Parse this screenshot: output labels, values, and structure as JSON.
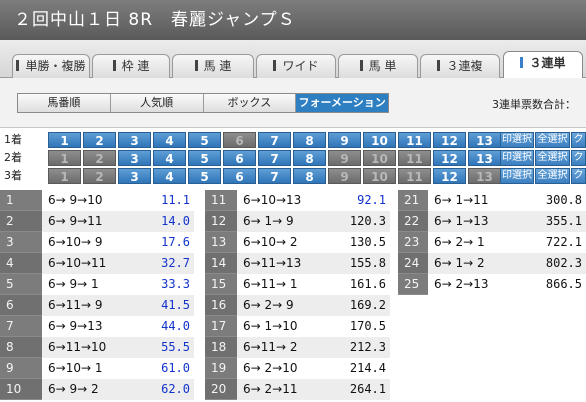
{
  "title": "２回中山１日 8R　春麗ジャンプＳ",
  "tabs": [
    {
      "label": "単勝・複勝",
      "active": false
    },
    {
      "label": "枠 連",
      "active": false
    },
    {
      "label": "馬 連",
      "active": false
    },
    {
      "label": "ワイド",
      "active": false
    },
    {
      "label": "馬 単",
      "active": false
    },
    {
      "label": "３連複",
      "active": false
    },
    {
      "label": "３連単",
      "active": true
    }
  ],
  "modes": [
    {
      "label": "馬番順",
      "active": false
    },
    {
      "label": "人気順",
      "active": false
    },
    {
      "label": "ボックス",
      "active": false
    },
    {
      "label": "フォーメーション",
      "active": true
    }
  ],
  "combo_count_label": "3連単票数合計：",
  "selector": {
    "rows": [
      {
        "label": "1着",
        "numbers": [
          {
            "n": "1",
            "on": true
          },
          {
            "n": "2",
            "on": true
          },
          {
            "n": "3",
            "on": true
          },
          {
            "n": "4",
            "on": true
          },
          {
            "n": "5",
            "on": true
          },
          {
            "n": "6",
            "on": false
          },
          {
            "n": "7",
            "on": true
          },
          {
            "n": "8",
            "on": true
          },
          {
            "n": "9",
            "on": true
          },
          {
            "n": "10",
            "on": true
          },
          {
            "n": "11",
            "on": true
          },
          {
            "n": "12",
            "on": true
          },
          {
            "n": "13",
            "on": true
          }
        ]
      },
      {
        "label": "2着",
        "numbers": [
          {
            "n": "1",
            "on": false
          },
          {
            "n": "2",
            "on": false
          },
          {
            "n": "3",
            "on": true
          },
          {
            "n": "4",
            "on": true
          },
          {
            "n": "5",
            "on": true
          },
          {
            "n": "6",
            "on": true
          },
          {
            "n": "7",
            "on": true
          },
          {
            "n": "8",
            "on": true
          },
          {
            "n": "9",
            "on": false
          },
          {
            "n": "10",
            "on": false
          },
          {
            "n": "11",
            "on": false
          },
          {
            "n": "12",
            "on": true
          },
          {
            "n": "13",
            "on": true
          }
        ]
      },
      {
        "label": "3着",
        "numbers": [
          {
            "n": "1",
            "on": false
          },
          {
            "n": "2",
            "on": false
          },
          {
            "n": "3",
            "on": true
          },
          {
            "n": "4",
            "on": true
          },
          {
            "n": "5",
            "on": true
          },
          {
            "n": "6",
            "on": true
          },
          {
            "n": "7",
            "on": true
          },
          {
            "n": "8",
            "on": true
          },
          {
            "n": "9",
            "on": false
          },
          {
            "n": "10",
            "on": false
          },
          {
            "n": "11",
            "on": false
          },
          {
            "n": "12",
            "on": true
          },
          {
            "n": "13",
            "on": false
          }
        ]
      }
    ],
    "actions": [
      "印選択",
      "全選択",
      "ク"
    ]
  },
  "results": {
    "columns": [
      {
        "rows": [
          {
            "rank": "1",
            "combo": "6→ 9→10",
            "odds": "11.1",
            "color": "blue"
          },
          {
            "rank": "2",
            "combo": "6→ 9→11",
            "odds": "14.0",
            "color": "blue"
          },
          {
            "rank": "3",
            "combo": "6→10→ 9",
            "odds": "17.6",
            "color": "blue"
          },
          {
            "rank": "4",
            "combo": "6→10→11",
            "odds": "32.7",
            "color": "blue"
          },
          {
            "rank": "5",
            "combo": "6→ 9→ 1",
            "odds": "33.3",
            "color": "blue"
          },
          {
            "rank": "6",
            "combo": "6→11→ 9",
            "odds": "41.5",
            "color": "blue"
          },
          {
            "rank": "7",
            "combo": "6→ 9→13",
            "odds": "44.0",
            "color": "blue"
          },
          {
            "rank": "8",
            "combo": "6→11→10",
            "odds": "55.5",
            "color": "blue"
          },
          {
            "rank": "9",
            "combo": "6→10→ 1",
            "odds": "61.0",
            "color": "blue"
          },
          {
            "rank": "10",
            "combo": "6→ 9→ 2",
            "odds": "62.0",
            "color": "blue"
          }
        ]
      },
      {
        "rows": [
          {
            "rank": "11",
            "combo": "6→10→13",
            "odds": "92.1",
            "color": "blue"
          },
          {
            "rank": "12",
            "combo": "6→ 1→ 9",
            "odds": "120.3",
            "color": "black"
          },
          {
            "rank": "13",
            "combo": "6→10→ 2",
            "odds": "130.5",
            "color": "black"
          },
          {
            "rank": "14",
            "combo": "6→11→13",
            "odds": "155.8",
            "color": "black"
          },
          {
            "rank": "15",
            "combo": "6→11→ 1",
            "odds": "161.6",
            "color": "black"
          },
          {
            "rank": "16",
            "combo": "6→ 2→ 9",
            "odds": "169.2",
            "color": "black"
          },
          {
            "rank": "17",
            "combo": "6→ 1→10",
            "odds": "170.5",
            "color": "black"
          },
          {
            "rank": "18",
            "combo": "6→11→ 2",
            "odds": "212.3",
            "color": "black"
          },
          {
            "rank": "19",
            "combo": "6→ 2→10",
            "odds": "214.4",
            "color": "black"
          },
          {
            "rank": "20",
            "combo": "6→ 2→11",
            "odds": "264.1",
            "color": "black"
          }
        ]
      },
      {
        "rows": [
          {
            "rank": "21",
            "combo": "6→ 1→11",
            "odds": "300.8",
            "color": "black"
          },
          {
            "rank": "22",
            "combo": "6→ 1→13",
            "odds": "355.1",
            "color": "black"
          },
          {
            "rank": "23",
            "combo": "6→ 2→ 1",
            "odds": "722.1",
            "color": "black"
          },
          {
            "rank": "24",
            "combo": "6→ 1→ 2",
            "odds": "802.3",
            "color": "black"
          },
          {
            "rank": "25",
            "combo": "6→ 2→13",
            "odds": "866.5",
            "color": "black"
          }
        ]
      }
    ]
  }
}
